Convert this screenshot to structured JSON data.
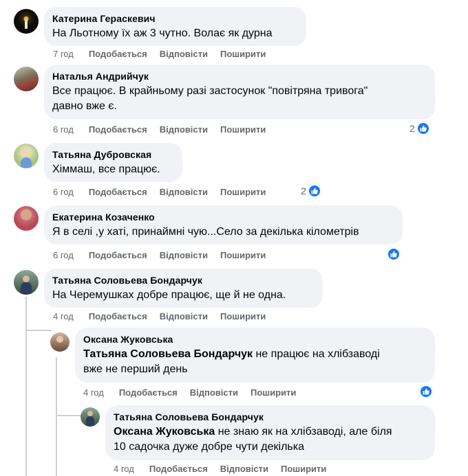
{
  "comments": [
    {
      "author": "Катерина Гераскевич",
      "text": "На Льотному їх аж 3 чутно. Волає як дурна",
      "time": "7 год",
      "like": "Подобається",
      "reply": "Відповісти",
      "share": "Поширити"
    },
    {
      "author": "Наталья Андрийчук",
      "text1": "Все працює. В крайньому разі застосунок \"повітряна тривога\"",
      "text2": "давно вже є.",
      "time": "6 год",
      "like": "Подобається",
      "reply": "Відповісти",
      "share": "Поширити",
      "reactions": "2"
    },
    {
      "author": "Татьяна Дубровская",
      "text": "Хіммаш, все працює.",
      "time": "6 год",
      "like": "Подобається",
      "reply": "Відповісти",
      "share": "Поширити",
      "reactions": "2"
    },
    {
      "author": "Екатерина Козаченко",
      "text": "Я в селі ,у хаті, принаймні чую...Село за декілька кілометрів",
      "time": "6 год",
      "like": "Подобається",
      "reply": "Відповісти",
      "share": "Поширити"
    },
    {
      "author": "Татьяна Соловьева Бондарчук",
      "text": "На Черемушках добре працює, ще й не одна.",
      "time": "4 год",
      "like": "Подобається",
      "reply": "Відповісти",
      "share": "Поширити"
    },
    {
      "author": "Оксана Жуковська",
      "mention": "Татьяна Соловьева Бондарчук",
      "text1": " не працює на хлібзаводі",
      "text2": "вже не перший день",
      "time": "4 год",
      "like": "Подобається",
      "reply": "Відповісти",
      "share": "Поширити"
    },
    {
      "author": "Татьяна Соловьева Бондарчук",
      "mention": "Оксана Жуковська",
      "text1": " не знаю як на хлібзаводі, але біля",
      "text2": "10 садочка дуже добре чути декілька",
      "time": "4 год",
      "like": "Подобається",
      "reply": "Відповісти",
      "share": "Поширити"
    }
  ],
  "colors": {
    "bubble": "#f0f2f5",
    "meta": "#65676b",
    "like": "#1877f2"
  }
}
